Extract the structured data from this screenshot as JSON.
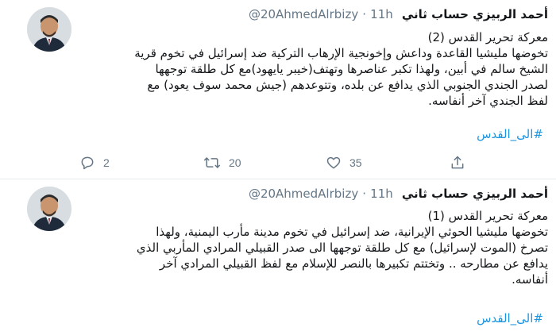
{
  "tweets": [
    {
      "author": {
        "name": "أحمد الربيزي حساب ثاني",
        "handle": "@20AhmedAlrbizy",
        "time": "11h"
      },
      "lines": [
        "معركة تحرير القدس (2)",
        "تخوضها مليشيا القاعدة وداعش وإخونجية الإرهاب التركية ضد إسرائيل في تخوم قرية",
        "الشيخ سالم في أبين، ولهذا تكبر عناصرها وتهتف(خيبر يايهود)مع كل طلقة توجهها",
        "لصدر الجندي الجنوبي الذي يدافع عن بلده، وتتوعدهم (جيش محمد سوف يعود) مع",
        "لفظ الجندي آخر أنفاسه."
      ],
      "hashtag": "#الى_القدس",
      "actions": {
        "replies": "2",
        "retweets": "20",
        "likes": "35"
      }
    },
    {
      "author": {
        "name": "أحمد الربيزي حساب ثاني",
        "handle": "@20AhmedAlrbizy",
        "time": "11h"
      },
      "lines": [
        "معركة تحرير القدس (1)",
        "تخوضها مليشيا الحوثي الإيرانية، ضد إسرائيل في تخوم مدينة مأرب اليمنية، ولهذا",
        "تصرخ (الموت لإسرائيل) مع كل طلقة توجهها الى صدر القبيلي المرادي المأربي الذي",
        "يدافع عن مطارحه .. وتختتم تكبيرها بالنصر للإسلام مع لفظ القبيلي المرادي آخر",
        "أنفاسه."
      ],
      "hashtag": "#الى_القدس"
    }
  ],
  "icons": {
    "reply": "reply-icon",
    "retweet": "retweet-icon",
    "like": "heart-icon",
    "share": "share-icon"
  },
  "colors": {
    "link": "#1b95e0",
    "muted": "#657786",
    "text": "#14171a"
  }
}
